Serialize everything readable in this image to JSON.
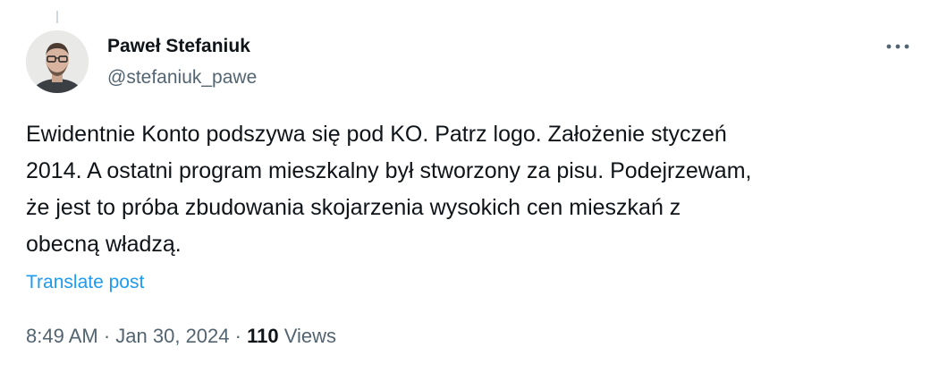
{
  "author": {
    "display_name": "Paweł Stefaniuk",
    "handle": "@stefaniuk_pawe",
    "avatar_icon": "profile-photo"
  },
  "more_icon": "more-horizontal-icon",
  "tweet": {
    "lines": [
      "Ewidentnie Konto podszywa się pod KO. Patrz logo. Założenie styczeń",
      "2014. A ostatni program mieszkalny był stworzony za pisu. Podejrzewam,",
      "że jest to próba zbudowania skojarzenia wysokich cen mieszkań z",
      "obecną władzą."
    ],
    "translate_label": "Translate post"
  },
  "meta": {
    "time": "8:49 AM",
    "separator": "·",
    "date": "Jan 30, 2024",
    "views_count": "110",
    "views_label": "Views"
  },
  "colors": {
    "text_primary": "#0f1419",
    "text_secondary": "#536471",
    "link": "#1d9bf0",
    "thread_line": "#cfd9de"
  }
}
